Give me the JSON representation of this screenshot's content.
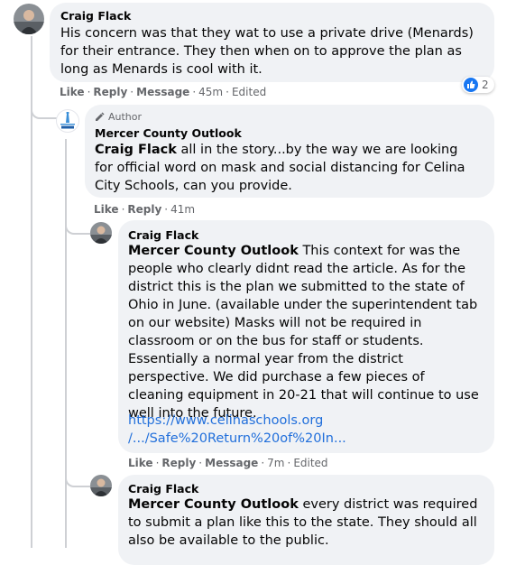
{
  "comments": [
    {
      "name": "Craig Flack",
      "text": "His concern was that they wat to use a private drive (Menards) for their entrance. They then when on to approve the plan as long as Menards is cool with it.",
      "actions": [
        "Like",
        "Reply",
        "Message"
      ],
      "time": "45m",
      "edited": "Edited",
      "reaction_count": "2"
    },
    {
      "author_badge": "Author",
      "name": "Mercer County Outlook",
      "tag": "Craig Flack",
      "text": " all in the story...by the way we are looking for official word on mask and social distancing for Celina City Schools, can you provide.",
      "actions": [
        "Like",
        "Reply"
      ],
      "time": "41m"
    },
    {
      "name": "Craig Flack",
      "tag": "Mercer County Outlook",
      "text": " This context for was the people who clearly didnt read the article. As for the district this is the plan we submitted to the state of Ohio in June. (available under the superintendent tab on our website) Masks will not be required in classroom or on the bus for staff or students. Essentially a normal year from the district perspective. We did purchase a few pieces of cleaning equipment in 20-21 that will continue to use well into the future.",
      "link_line1": "https://www.celinaschools.org",
      "link_line2": "/.../Safe%20Return%20of%20In...",
      "actions": [
        "Like",
        "Reply",
        "Message"
      ],
      "time": "7m",
      "edited": "Edited"
    },
    {
      "name": "Craig Flack",
      "tag": "Mercer County Outlook",
      "text": " every district was required to submit a plan like this to the state. They should all also be available to the public."
    }
  ],
  "colors": {
    "bubble": "#f0f2f5",
    "link": "#216fdb",
    "muted": "#65676b",
    "like_blue": "#1877f2"
  },
  "icons": [
    "avatar-photo",
    "like-icon",
    "pencil-icon",
    "outlook-logo"
  ]
}
